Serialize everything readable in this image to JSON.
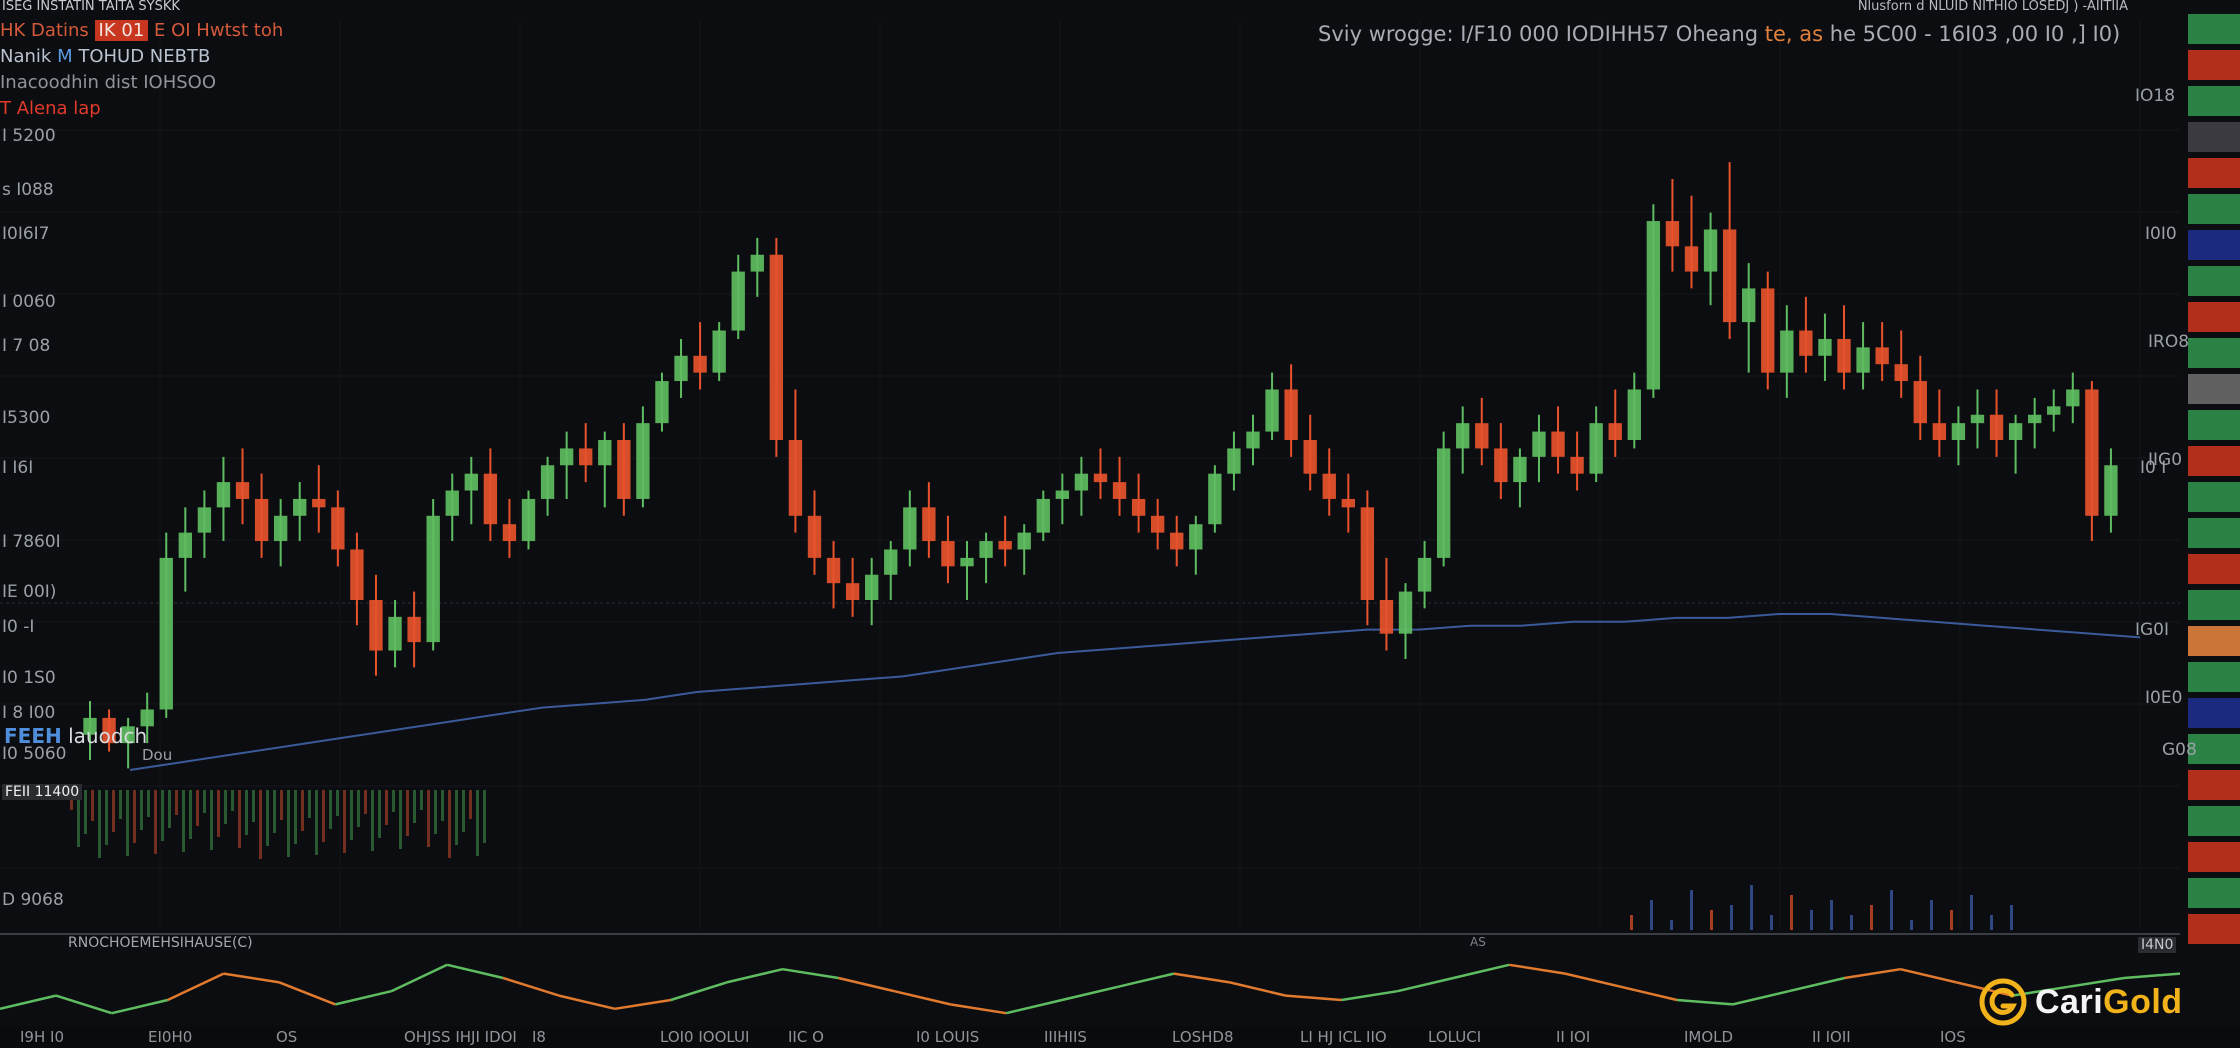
{
  "header": {
    "symbol_line": "ISEG INSTATIN TAITA SYSKK",
    "right_line": "Nlusforn d  NLUID NITHIO LOSEDJ  ) -AIITIIA"
  },
  "info": {
    "line1_prefix": "HK Datins",
    "line1_tag": "IK 01",
    "line1_rest": "E OI Hwtst toh",
    "line2_prefix": "Nanik",
    "line2_blue": "M",
    "line2_rest": "TOHUD NEBTB",
    "line3": "Inacoodhin dist  IOHSOO",
    "line4": "T Alena lap"
  },
  "headline": {
    "prefix": "Sviy wrogge: I/F10 000 IODIHH57 Oheang",
    "orange": "te, as",
    "suffix": "he 5C00 - 16I03 ,00 I0 ,] I0)"
  },
  "left_axis": [
    "I 5200",
    "s I088",
    "I0I6I7",
    "I 0060",
    "I 7 08",
    "I5300",
    "I I6I",
    "I 7860I",
    "IE 00I)",
    "I0 -I",
    "I0 1S0",
    "I 8 I00",
    "I0 5060",
    "D 9068"
  ],
  "right_axis": [
    "IO18",
    "I0I0",
    "IRO8",
    "IIG0",
    "I0 I",
    "IG0I",
    "I0E0",
    "G08"
  ],
  "series_label": {
    "blue": "FEEH",
    "rest": "lauodch",
    "sub": "Dou"
  },
  "small_tag": "FEII 11400",
  "oscillator": {
    "label": "RNOCHOEMEHSIHAUSE(C)",
    "mark": "AS",
    "value": "I4N0"
  },
  "time_axis": [
    "I9H I0",
    "EI0H0",
    "OS",
    "OHJSS IHJI IDOI",
    "I8",
    "LOI0 IOOLUI",
    "IIC O",
    "I0 LOUIS",
    "IIIHIIS",
    "LOSHD8",
    "LI HJ ICL IIO",
    "LOLUCI",
    "II IOI",
    "IMOLD",
    "II IOII",
    "IOS"
  ],
  "logo": {
    "word_a": "Cari",
    "word_b": "Gold"
  },
  "colors": {
    "background": "#0c0d10",
    "up": "#5fbd61",
    "down": "#e8532c",
    "blue_line": "#3a5a9a",
    "volume_up": "#4a9a55",
    "volume_blue": "#3f63b5",
    "gold": "#f2b21a"
  },
  "chart_data": {
    "type": "candlestick",
    "title": "",
    "ylim": [
      0,
      100
    ],
    "candles": [
      {
        "o": 14,
        "h": 22,
        "l": 8,
        "c": 18
      },
      {
        "o": 18,
        "h": 20,
        "l": 10,
        "c": 12
      },
      {
        "o": 12,
        "h": 18,
        "l": 6,
        "c": 16
      },
      {
        "o": 16,
        "h": 24,
        "l": 12,
        "c": 20
      },
      {
        "o": 20,
        "h": 62,
        "l": 18,
        "c": 56
      },
      {
        "o": 56,
        "h": 68,
        "l": 48,
        "c": 62
      },
      {
        "o": 62,
        "h": 72,
        "l": 56,
        "c": 68
      },
      {
        "o": 68,
        "h": 80,
        "l": 60,
        "c": 74
      },
      {
        "o": 74,
        "h": 82,
        "l": 64,
        "c": 70
      },
      {
        "o": 70,
        "h": 76,
        "l": 56,
        "c": 60
      },
      {
        "o": 60,
        "h": 70,
        "l": 54,
        "c": 66
      },
      {
        "o": 66,
        "h": 74,
        "l": 60,
        "c": 70
      },
      {
        "o": 70,
        "h": 78,
        "l": 62,
        "c": 68
      },
      {
        "o": 68,
        "h": 72,
        "l": 54,
        "c": 58
      },
      {
        "o": 58,
        "h": 62,
        "l": 40,
        "c": 46
      },
      {
        "o": 46,
        "h": 52,
        "l": 28,
        "c": 34
      },
      {
        "o": 34,
        "h": 46,
        "l": 30,
        "c": 42
      },
      {
        "o": 42,
        "h": 48,
        "l": 30,
        "c": 36
      },
      {
        "o": 36,
        "h": 70,
        "l": 34,
        "c": 66
      },
      {
        "o": 66,
        "h": 76,
        "l": 60,
        "c": 72
      },
      {
        "o": 72,
        "h": 80,
        "l": 64,
        "c": 76
      },
      {
        "o": 76,
        "h": 82,
        "l": 60,
        "c": 64
      },
      {
        "o": 64,
        "h": 70,
        "l": 56,
        "c": 60
      },
      {
        "o": 60,
        "h": 72,
        "l": 58,
        "c": 70
      },
      {
        "o": 70,
        "h": 80,
        "l": 66,
        "c": 78
      },
      {
        "o": 78,
        "h": 86,
        "l": 70,
        "c": 82
      },
      {
        "o": 82,
        "h": 88,
        "l": 74,
        "c": 78
      },
      {
        "o": 78,
        "h": 86,
        "l": 68,
        "c": 84
      },
      {
        "o": 84,
        "h": 88,
        "l": 66,
        "c": 70
      },
      {
        "o": 70,
        "h": 92,
        "l": 68,
        "c": 88
      },
      {
        "o": 88,
        "h": 100,
        "l": 86,
        "c": 98
      },
      {
        "o": 98,
        "h": 108,
        "l": 94,
        "c": 104
      },
      {
        "o": 104,
        "h": 112,
        "l": 96,
        "c": 100
      },
      {
        "o": 100,
        "h": 112,
        "l": 98,
        "c": 110
      },
      {
        "o": 110,
        "h": 128,
        "l": 108,
        "c": 124
      },
      {
        "o": 124,
        "h": 132,
        "l": 118,
        "c": 128
      },
      {
        "o": 128,
        "h": 132,
        "l": 80,
        "c": 84
      },
      {
        "o": 84,
        "h": 96,
        "l": 62,
        "c": 66
      },
      {
        "o": 66,
        "h": 72,
        "l": 52,
        "c": 56
      },
      {
        "o": 56,
        "h": 60,
        "l": 44,
        "c": 50
      },
      {
        "o": 50,
        "h": 56,
        "l": 42,
        "c": 46
      },
      {
        "o": 46,
        "h": 56,
        "l": 40,
        "c": 52
      },
      {
        "o": 52,
        "h": 60,
        "l": 46,
        "c": 58
      },
      {
        "o": 58,
        "h": 72,
        "l": 54,
        "c": 68
      },
      {
        "o": 68,
        "h": 74,
        "l": 56,
        "c": 60
      },
      {
        "o": 60,
        "h": 66,
        "l": 50,
        "c": 54
      },
      {
        "o": 54,
        "h": 60,
        "l": 46,
        "c": 56
      },
      {
        "o": 56,
        "h": 62,
        "l": 50,
        "c": 60
      },
      {
        "o": 60,
        "h": 66,
        "l": 54,
        "c": 58
      },
      {
        "o": 58,
        "h": 64,
        "l": 52,
        "c": 62
      },
      {
        "o": 62,
        "h": 72,
        "l": 60,
        "c": 70
      },
      {
        "o": 70,
        "h": 76,
        "l": 64,
        "c": 72
      },
      {
        "o": 72,
        "h": 80,
        "l": 66,
        "c": 76
      },
      {
        "o": 76,
        "h": 82,
        "l": 70,
        "c": 74
      },
      {
        "o": 74,
        "h": 80,
        "l": 66,
        "c": 70
      },
      {
        "o": 70,
        "h": 76,
        "l": 62,
        "c": 66
      },
      {
        "o": 66,
        "h": 70,
        "l": 58,
        "c": 62
      },
      {
        "o": 62,
        "h": 66,
        "l": 54,
        "c": 58
      },
      {
        "o": 58,
        "h": 66,
        "l": 52,
        "c": 64
      },
      {
        "o": 64,
        "h": 78,
        "l": 62,
        "c": 76
      },
      {
        "o": 76,
        "h": 86,
        "l": 72,
        "c": 82
      },
      {
        "o": 82,
        "h": 90,
        "l": 78,
        "c": 86
      },
      {
        "o": 86,
        "h": 100,
        "l": 84,
        "c": 96
      },
      {
        "o": 96,
        "h": 102,
        "l": 80,
        "c": 84
      },
      {
        "o": 84,
        "h": 90,
        "l": 72,
        "c": 76
      },
      {
        "o": 76,
        "h": 82,
        "l": 66,
        "c": 70
      },
      {
        "o": 70,
        "h": 76,
        "l": 62,
        "c": 68
      },
      {
        "o": 68,
        "h": 72,
        "l": 40,
        "c": 46
      },
      {
        "o": 46,
        "h": 56,
        "l": 34,
        "c": 38
      },
      {
        "o": 38,
        "h": 50,
        "l": 32,
        "c": 48
      },
      {
        "o": 48,
        "h": 60,
        "l": 44,
        "c": 56
      },
      {
        "o": 56,
        "h": 86,
        "l": 54,
        "c": 82
      },
      {
        "o": 82,
        "h": 92,
        "l": 76,
        "c": 88
      },
      {
        "o": 88,
        "h": 94,
        "l": 78,
        "c": 82
      },
      {
        "o": 82,
        "h": 88,
        "l": 70,
        "c": 74
      },
      {
        "o": 74,
        "h": 82,
        "l": 68,
        "c": 80
      },
      {
        "o": 80,
        "h": 90,
        "l": 74,
        "c": 86
      },
      {
        "o": 86,
        "h": 92,
        "l": 76,
        "c": 80
      },
      {
        "o": 80,
        "h": 86,
        "l": 72,
        "c": 76
      },
      {
        "o": 76,
        "h": 92,
        "l": 74,
        "c": 88
      },
      {
        "o": 88,
        "h": 96,
        "l": 80,
        "c": 84
      },
      {
        "o": 84,
        "h": 100,
        "l": 82,
        "c": 96
      },
      {
        "o": 96,
        "h": 140,
        "l": 94,
        "c": 136
      },
      {
        "o": 136,
        "h": 146,
        "l": 124,
        "c": 130
      },
      {
        "o": 130,
        "h": 142,
        "l": 120,
        "c": 124
      },
      {
        "o": 124,
        "h": 138,
        "l": 116,
        "c": 134
      },
      {
        "o": 134,
        "h": 150,
        "l": 108,
        "c": 112
      },
      {
        "o": 112,
        "h": 126,
        "l": 100,
        "c": 120
      },
      {
        "o": 120,
        "h": 124,
        "l": 96,
        "c": 100
      },
      {
        "o": 100,
        "h": 116,
        "l": 94,
        "c": 110
      },
      {
        "o": 110,
        "h": 118,
        "l": 100,
        "c": 104
      },
      {
        "o": 104,
        "h": 114,
        "l": 98,
        "c": 108
      },
      {
        "o": 108,
        "h": 116,
        "l": 96,
        "c": 100
      },
      {
        "o": 100,
        "h": 112,
        "l": 96,
        "c": 106
      },
      {
        "o": 106,
        "h": 112,
        "l": 98,
        "c": 102
      },
      {
        "o": 102,
        "h": 110,
        "l": 94,
        "c": 98
      },
      {
        "o": 98,
        "h": 104,
        "l": 84,
        "c": 88
      },
      {
        "o": 88,
        "h": 96,
        "l": 80,
        "c": 84
      },
      {
        "o": 84,
        "h": 92,
        "l": 78,
        "c": 88
      },
      {
        "o": 88,
        "h": 96,
        "l": 82,
        "c": 90
      },
      {
        "o": 90,
        "h": 96,
        "l": 80,
        "c": 84
      },
      {
        "o": 84,
        "h": 90,
        "l": 76,
        "c": 88
      },
      {
        "o": 88,
        "h": 94,
        "l": 82,
        "c": 90
      },
      {
        "o": 90,
        "h": 96,
        "l": 86,
        "c": 92
      },
      {
        "o": 92,
        "h": 100,
        "l": 88,
        "c": 96
      },
      {
        "o": 96,
        "h": 98,
        "l": 60,
        "c": 66
      },
      {
        "o": 66,
        "h": 82,
        "l": 62,
        "c": 78
      }
    ],
    "blue_line": [
      40,
      42,
      44,
      46,
      48,
      50,
      52,
      54,
      56,
      57,
      58,
      60,
      61,
      62,
      63,
      64,
      66,
      68,
      70,
      71,
      72,
      73,
      74,
      75,
      76,
      76,
      77,
      77,
      78,
      78,
      79,
      79,
      80,
      80,
      79,
      78,
      77,
      76,
      75,
      74
    ],
    "volume": [
      3,
      6,
      2,
      8,
      4,
      5,
      9,
      3,
      7,
      4,
      6,
      3,
      5,
      8,
      2,
      6,
      4,
      7,
      3,
      5
    ],
    "oscillator": [
      46,
      52,
      44,
      50,
      62,
      58,
      48,
      54,
      66,
      60,
      52,
      46,
      50,
      58,
      64,
      60,
      54,
      48,
      44,
      50,
      56,
      62,
      58,
      52,
      50,
      54,
      60,
      66,
      62,
      56,
      50,
      48,
      54,
      60,
      64,
      58,
      52,
      56,
      60,
      62
    ]
  }
}
